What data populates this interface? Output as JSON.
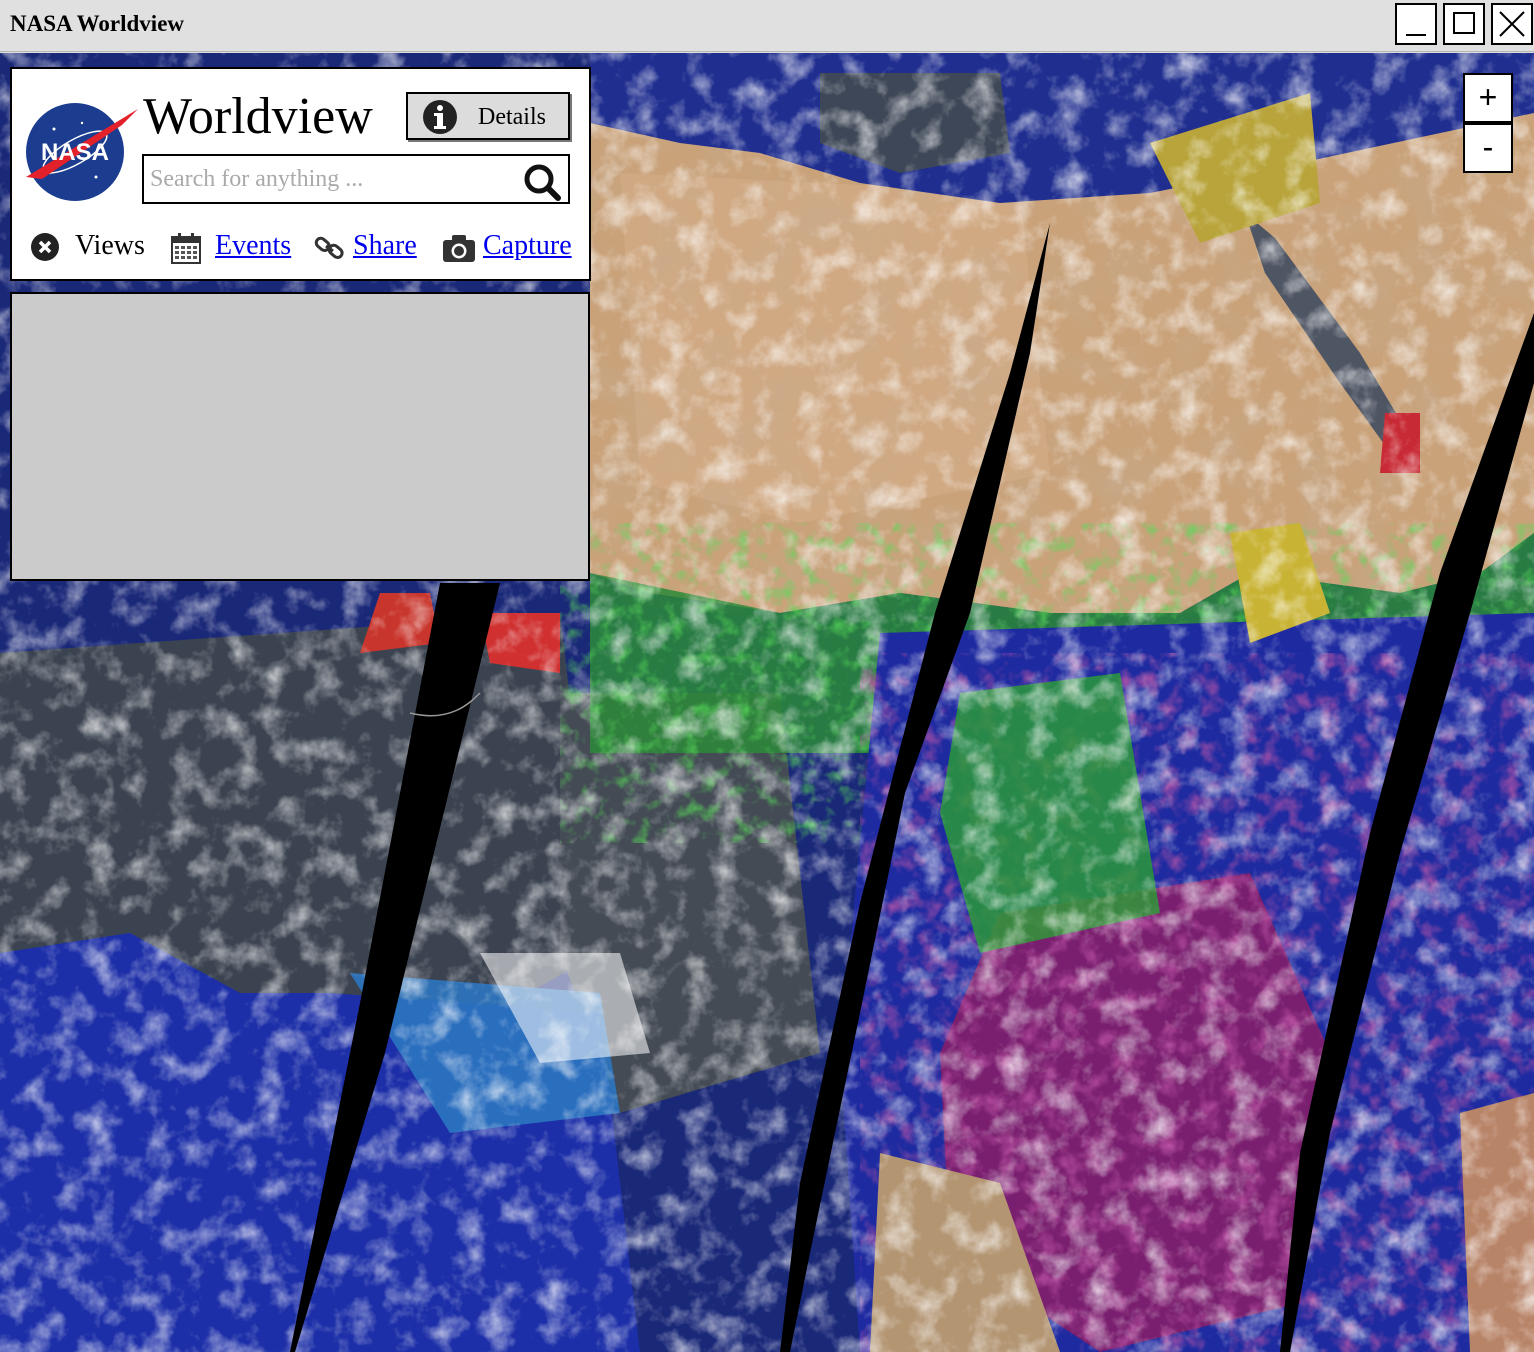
{
  "window": {
    "title": "NASA Worldview",
    "minimize_icon": "minimize-icon",
    "maximize_icon": "maximize-icon",
    "close_icon": "close-icon"
  },
  "header": {
    "logo_text": "NASA",
    "app_title": "Worldview",
    "details_button": {
      "label": "Details",
      "icon": "info-icon"
    },
    "search": {
      "placeholder": "Search for anything ...",
      "value": "",
      "icon": "search-icon"
    }
  },
  "nav": {
    "views": {
      "label": "Views",
      "icon": "close-circle-icon"
    },
    "events": {
      "label": "Events",
      "icon": "calendar-icon"
    },
    "share": {
      "label": "Share",
      "icon": "link-icon"
    },
    "capture": {
      "label": "Capture",
      "icon": "camera-icon"
    }
  },
  "map": {
    "zoom_in_label": "+",
    "zoom_out_label": "-"
  },
  "colors": {
    "titlebar_bg": "#e0e0e0",
    "link": "#0000ee",
    "panel_grey": "#cbcbcb",
    "nasa_blue": "#1b3c8f",
    "nasa_red": "#e3212a"
  }
}
